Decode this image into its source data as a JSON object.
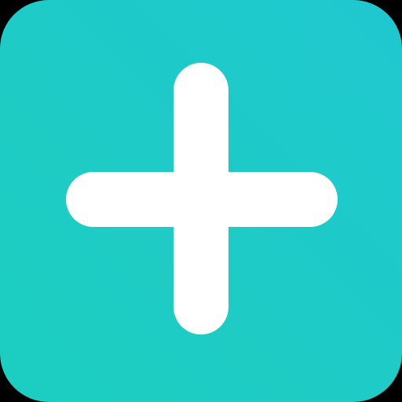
{
  "app_icon": {
    "icon": "plus-icon",
    "background_color": "#1ECBC6",
    "foreground_color": "#FFFFFF"
  }
}
